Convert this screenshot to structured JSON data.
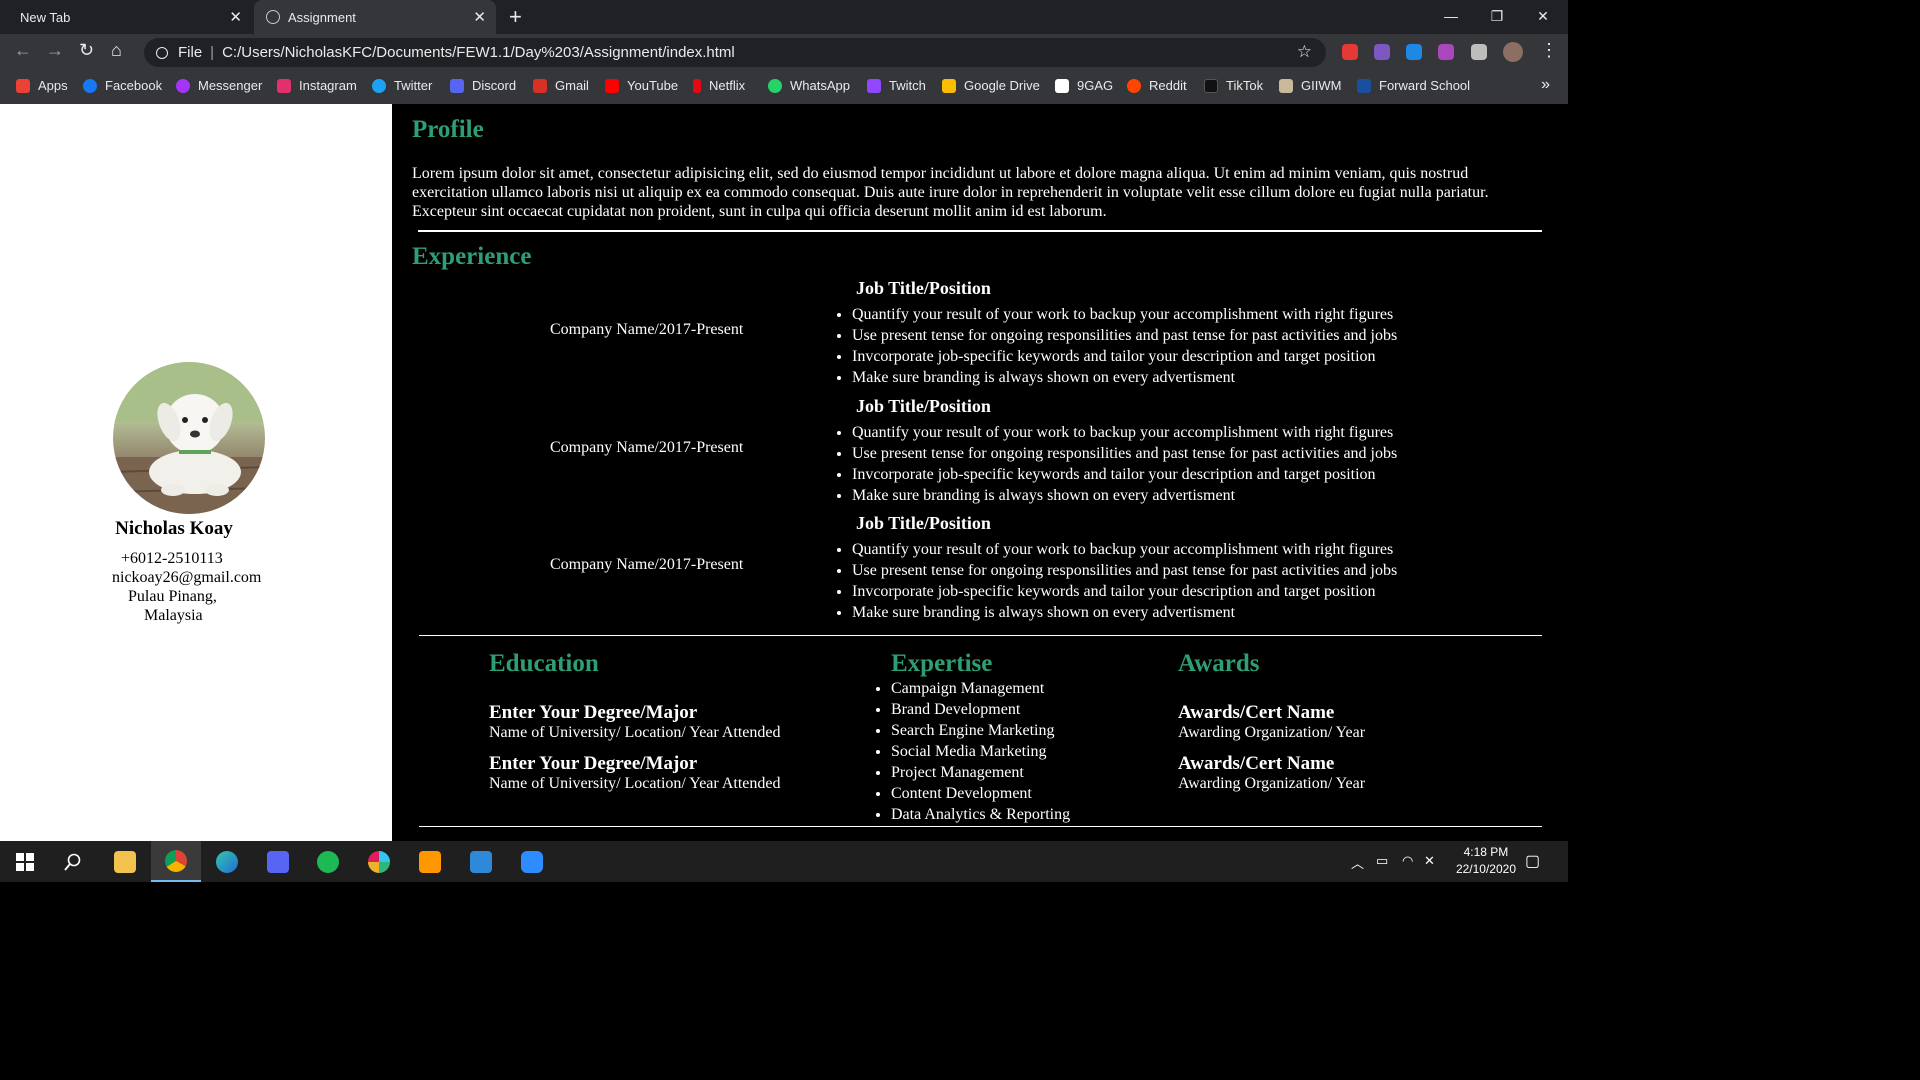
{
  "browser": {
    "tabs": [
      {
        "title": "New Tab"
      },
      {
        "title": "Assignment"
      }
    ],
    "new_tab_symbol": "+",
    "url_scheme": "File",
    "url": "C:/Users/NicholasKFC/Documents/FEW1.1/Day%203/Assignment/index.html",
    "bookmarks": [
      {
        "label": "Apps",
        "color": "#ea4335"
      },
      {
        "label": "Facebook",
        "color": "#1877f2"
      },
      {
        "label": "Messenger",
        "color": "#a334fa"
      },
      {
        "label": "Instagram",
        "color": "#e1306c"
      },
      {
        "label": "Twitter",
        "color": "#1da1f2"
      },
      {
        "label": "Discord",
        "color": "#5865f2"
      },
      {
        "label": "Gmail",
        "color": "#d93025"
      },
      {
        "label": "YouTube",
        "color": "#ff0000"
      },
      {
        "label": "Netflix",
        "color": "#e50914"
      },
      {
        "label": "WhatsApp",
        "color": "#25d366"
      },
      {
        "label": "Twitch",
        "color": "#9146ff"
      },
      {
        "label": "Google Drive",
        "color": "#fbbc04"
      },
      {
        "label": "9GAG",
        "color": "#ffffff"
      },
      {
        "label": "Reddit",
        "color": "#ff4500"
      },
      {
        "label": "TikTok",
        "color": "#111111"
      },
      {
        "label": "GIIWM",
        "color": "#c9b99a"
      },
      {
        "label": "Forward School",
        "color": "#1a4fa0"
      }
    ]
  },
  "resume": {
    "name": "Nicholas Koay",
    "phone": "+6012-2510113",
    "email": "nickoay26@gmail.com",
    "city": "Pulau Pinang,",
    "country": "Malaysia",
    "profile_heading": "Profile",
    "profile_text": "Lorem ipsum dolor sit amet, consectetur adipisicing elit, sed do eiusmod tempor incididunt ut labore et dolore magna aliqua. Ut enim ad minim veniam, quis nostrud exercitation ullamco laboris nisi ut aliquip ex ea commodo consequat. Duis aute irure dolor in reprehenderit in voluptate velit esse cillum dolore eu fugiat nulla pariatur. Excepteur sint occaecat cupidatat non proident, sunt in culpa qui officia deserunt mollit anim id est laborum.",
    "experience_heading": "Experience",
    "experience": [
      {
        "company": "Company Name/2017-Present",
        "title": "Job Title/Position",
        "bullets": [
          "Quantify your result of your work to backup your accomplishment with right figures",
          "Use present tense for ongoing responsilities and past tense for past activities and jobs",
          "Invcorporate job-specific keywords and tailor your description and target position",
          "Make sure branding is always shown on every advertisment"
        ]
      },
      {
        "company": "Company Name/2017-Present",
        "title": "Job Title/Position",
        "bullets": [
          "Quantify your result of your work to backup your accomplishment with right figures",
          "Use present tense for ongoing responsilities and past tense for past activities and jobs",
          "Invcorporate job-specific keywords and tailor your description and target position",
          "Make sure branding is always shown on every advertisment"
        ]
      },
      {
        "company": "Company Name/2017-Present",
        "title": "Job Title/Position",
        "bullets": [
          "Quantify your result of your work to backup your accomplishment with right figures",
          "Use present tense for ongoing responsilities and past tense for past activities and jobs",
          "Invcorporate job-specific keywords and tailor your description and target position",
          "Make sure branding is always shown on every advertisment"
        ]
      }
    ],
    "education_heading": "Education",
    "education": [
      {
        "degree": "Enter Your Degree/Major",
        "school": "Name of University/ Location/ Year Attended"
      },
      {
        "degree": "Enter Your Degree/Major",
        "school": "Name of University/ Location/ Year Attended"
      }
    ],
    "expertise_heading": "Expertise",
    "expertise": [
      "Campaign Management",
      "Brand Development",
      "Search Engine Marketing",
      "Social Media Marketing",
      "Project Management",
      "Content Development",
      "Data Analytics & Reporting"
    ],
    "awards_heading": "Awards",
    "awards": [
      {
        "name": "Awards/Cert Name",
        "org": "Awarding Organization/ Year"
      },
      {
        "name": "Awards/Cert Name",
        "org": "Awarding Organization/ Year"
      }
    ],
    "accent_color": "#2e9e74"
  },
  "taskbar": {
    "time": "4:18 PM",
    "date": "22/10/2020"
  }
}
